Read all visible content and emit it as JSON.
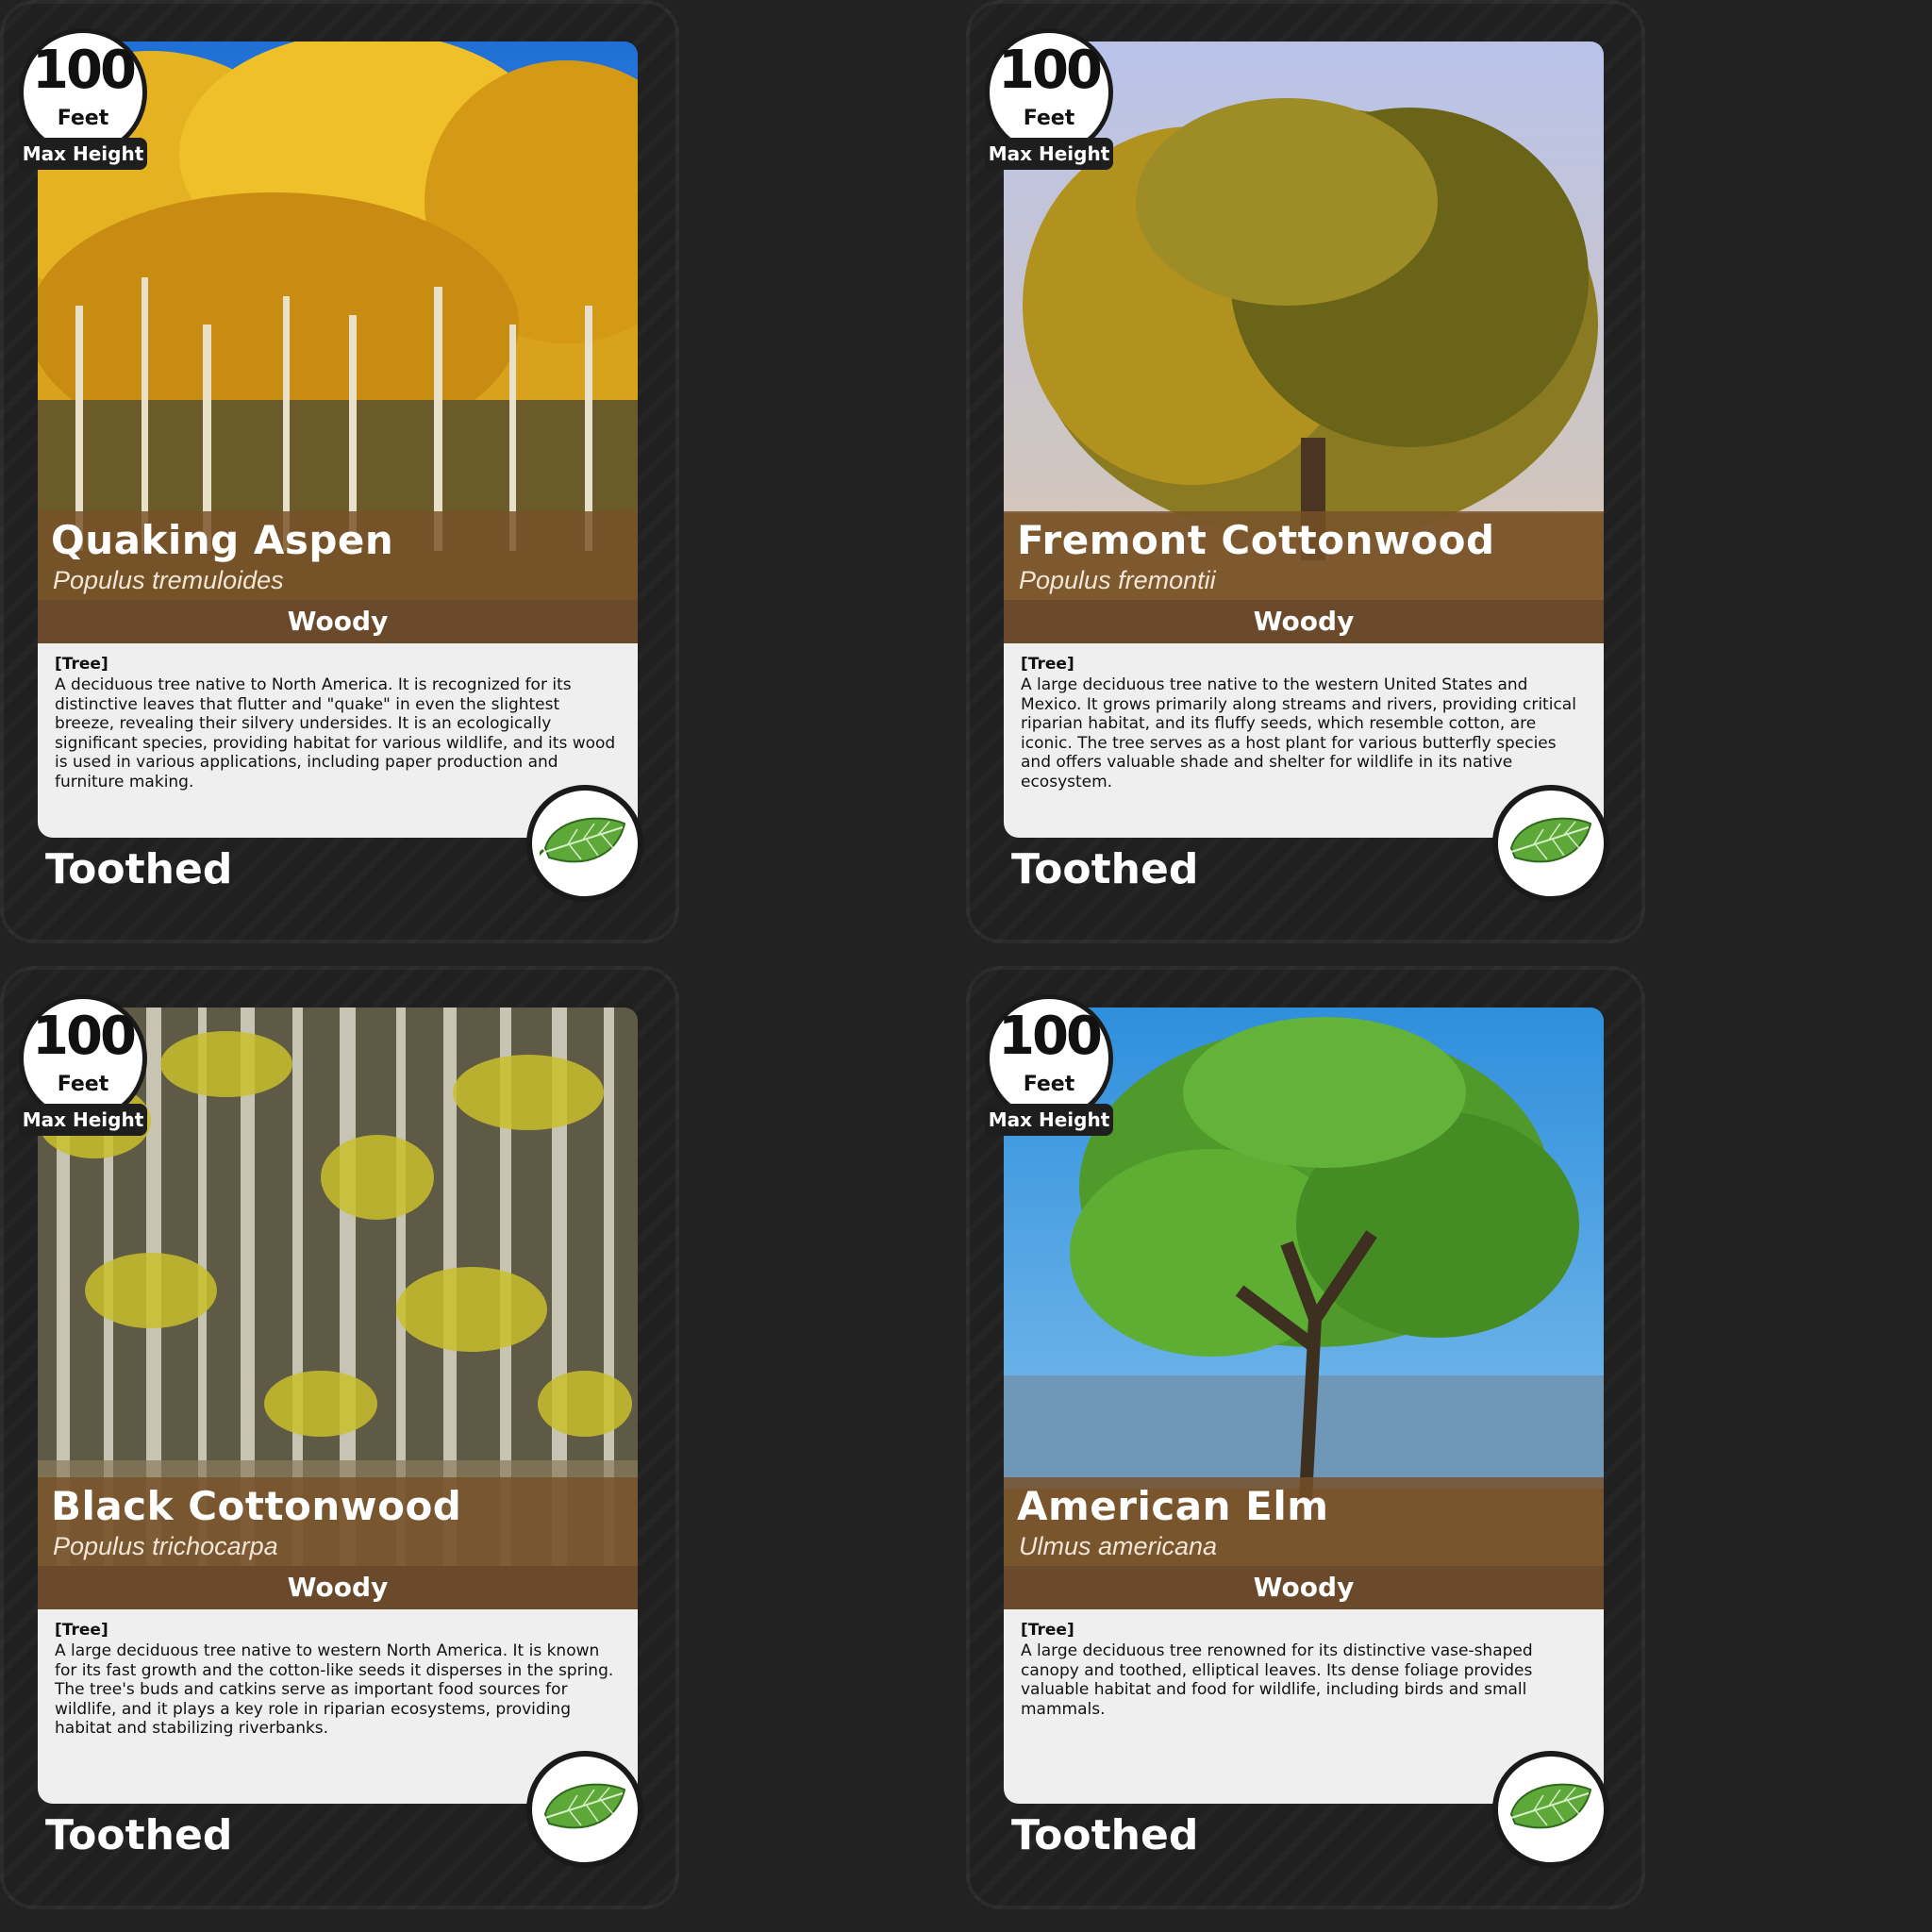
{
  "cards": [
    {
      "height_value": "100",
      "height_unit": "Feet",
      "height_label": "Max Height",
      "common_name": "Quaking Aspen",
      "scientific_name": "Populus tremuloides",
      "category": "Woody",
      "form": "[Tree]",
      "description": "A deciduous tree native to North America. It is recognized for its distinctive leaves that flutter and \"quake\" in even the slightest breeze, revealing their silvery undersides. It is an ecologically significant species, providing habitat for various wildlife, and its wood is used in various applications, including paper production and furniture making.",
      "leaf_type": "Toothed",
      "leaf_icon": "toothed-leaf-icon"
    },
    {
      "height_value": "100",
      "height_unit": "Feet",
      "height_label": "Max Height",
      "common_name": "Fremont Cottonwood",
      "scientific_name": "Populus fremontii",
      "category": "Woody",
      "form": "[Tree]",
      "description": "A large deciduous tree native to the western United States and Mexico. It grows primarily along streams and rivers, providing critical riparian habitat, and its fluffy seeds, which resemble cotton, are iconic. The tree serves as a host plant for various butterfly species and offers valuable shade and shelter for wildlife in its native ecosystem.",
      "leaf_type": "Toothed",
      "leaf_icon": "toothed-leaf-icon"
    },
    {
      "height_value": "100",
      "height_unit": "Feet",
      "height_label": "Max Height",
      "common_name": "Black Cottonwood",
      "scientific_name": "Populus trichocarpa",
      "category": "Woody",
      "form": "[Tree]",
      "description": "A large deciduous tree native to western North America. It is known for its fast growth and the cotton-like seeds it disperses in the spring. The tree's buds and catkins serve as important food sources for wildlife, and it plays a key role in riparian ecosystems, providing habitat and stabilizing riverbanks.",
      "leaf_type": "Toothed",
      "leaf_icon": "toothed-leaf-icon"
    },
    {
      "height_value": "100",
      "height_unit": "Feet",
      "height_label": "Max Height",
      "common_name": "American Elm",
      "scientific_name": "Ulmus americana",
      "category": "Woody",
      "form": "[Tree]",
      "description": "A large deciduous tree renowned for its distinctive vase-shaped canopy and toothed, elliptical leaves. Its dense foliage provides valuable habitat and food for wildlife, including birds and small mammals.",
      "leaf_type": "Toothed",
      "leaf_icon": "toothed-leaf-icon"
    }
  ],
  "colors": {
    "card_bg": "#202020",
    "name_band": "#7a5230",
    "type_band": "#6b4a2c",
    "description_bg": "#efefef",
    "leaf_green": "#5ea83a"
  }
}
